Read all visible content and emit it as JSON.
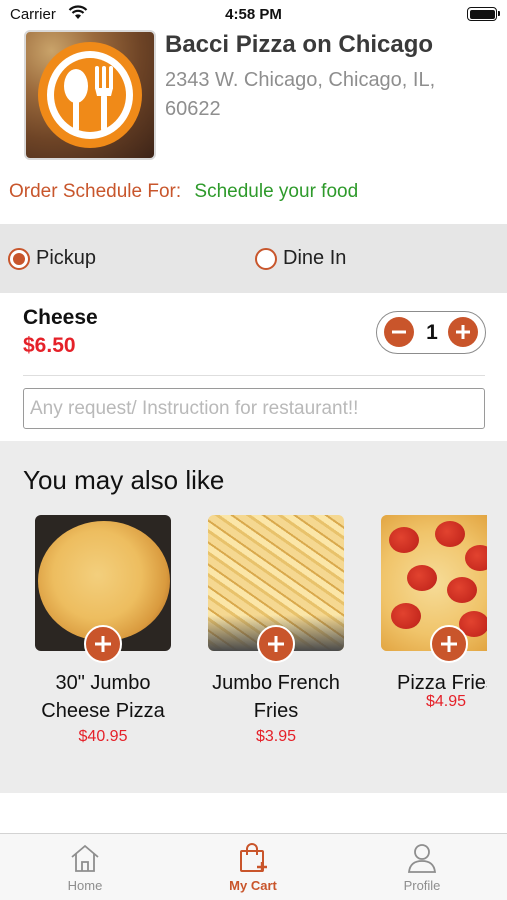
{
  "status_bar": {
    "carrier": "Carrier",
    "time": "4:58 PM"
  },
  "restaurant": {
    "name": "Bacci Pizza on Chicago",
    "address": "2343 W. Chicago, Chicago, IL, 60622"
  },
  "schedule": {
    "label": "Order Schedule For:",
    "value": "Schedule your food"
  },
  "order_type": {
    "options": [
      {
        "label": "Pickup",
        "selected": true
      },
      {
        "label": "Dine In",
        "selected": false
      }
    ]
  },
  "cart_item": {
    "name": "Cheese",
    "price": "$6.50",
    "quantity": "1"
  },
  "request": {
    "placeholder": "Any request/ Instruction for restaurant!!",
    "value": ""
  },
  "suggestions": {
    "title": "You may also like",
    "items": [
      {
        "name_line1": "30\" Jumbo",
        "name_line2": "Cheese Pizza",
        "price": "$40.95"
      },
      {
        "name_line1": "Jumbo French",
        "name_line2": "Fries",
        "price": "$3.95"
      },
      {
        "name_line1": "Pizza Fries",
        "name_line2": "",
        "price": "$4.95"
      }
    ]
  },
  "tab_bar": {
    "tabs": [
      {
        "label": "Home",
        "icon": "home-icon",
        "active": false
      },
      {
        "label": "My Cart",
        "icon": "cart-bag-icon",
        "active": true
      },
      {
        "label": "Profile",
        "icon": "profile-icon",
        "active": false
      }
    ]
  },
  "colors": {
    "accent": "#c9552b",
    "price": "#e52129",
    "schedule_value": "#2e9a2b",
    "logo_orange": "#f08a18"
  }
}
